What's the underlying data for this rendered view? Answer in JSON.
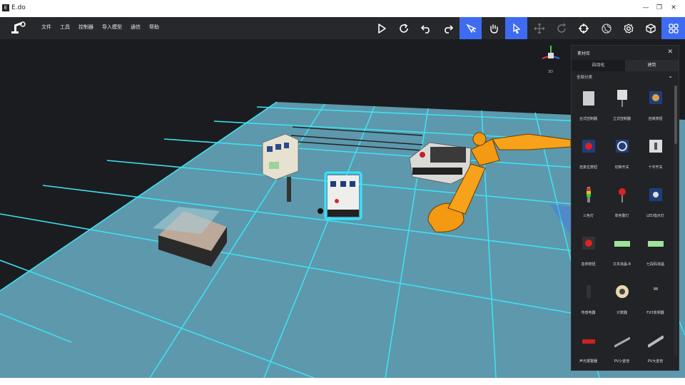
{
  "window": {
    "title": "E.do",
    "icon": "app-icon",
    "controls": [
      "—",
      "❐",
      "✕"
    ]
  },
  "menu": [
    "文件",
    "工具",
    "控制器",
    "导入模型",
    "通信",
    "帮助"
  ],
  "toolbar": {
    "buttons": [
      {
        "name": "play-icon",
        "active": false
      },
      {
        "name": "refresh-icon",
        "active": false
      },
      {
        "name": "undo-icon",
        "active": false
      },
      {
        "name": "redo-icon",
        "active": false
      },
      {
        "name": "pointer-pen-icon",
        "active": true
      },
      {
        "name": "hand-gesture-icon",
        "active": false
      },
      {
        "name": "cursor-icon",
        "active": true
      },
      {
        "name": "move-icon",
        "active": false
      },
      {
        "name": "rotate-icon",
        "active": false
      },
      {
        "name": "target-icon",
        "active": false
      },
      {
        "name": "globe-icon",
        "active": false
      },
      {
        "name": "settings-icon",
        "active": false
      },
      {
        "name": "cube-icon",
        "active": false
      },
      {
        "name": "apps-grid-icon",
        "active": true
      }
    ],
    "active_color": "#3d6cf2"
  },
  "viewport": {
    "view_label": "3D",
    "floor_color": "#5d98ad",
    "grid_line_color": "#3fe0f0"
  },
  "library_panel": {
    "title": "素材库",
    "close": "✕",
    "tabs": [
      "自动化",
      "建筑"
    ],
    "active_tab": 0,
    "category": "全部分类",
    "items": [
      {
        "label": "台式控制器",
        "icon": "desktop-controller-icon"
      },
      {
        "label": "立式控制器",
        "icon": "standing-controller-icon"
      },
      {
        "label": "自锁按钮",
        "icon": "self-lock-button-icon"
      },
      {
        "label": "自复位按钮",
        "icon": "reset-button-icon"
      },
      {
        "label": "切换开关",
        "icon": "toggle-switch-icon"
      },
      {
        "label": "十字开关",
        "icon": "cross-switch-icon"
      },
      {
        "label": "三色灯",
        "icon": "tri-color-light-icon"
      },
      {
        "label": "单色警灯",
        "icon": "warning-light-icon"
      },
      {
        "label": "LED指示灯",
        "icon": "led-indicator-icon"
      },
      {
        "label": "急停按钮",
        "icon": "emergency-stop-icon"
      },
      {
        "label": "文本液晶-8",
        "icon": "text-lcd-icon"
      },
      {
        "label": "七段码液晶",
        "icon": "seven-segment-lcd-icon"
      },
      {
        "label": "传感电器",
        "icon": "sensor-icon"
      },
      {
        "label": "计数器",
        "icon": "counter-icon"
      },
      {
        "label": "FX3变频器",
        "icon": "inverter-icon"
      },
      {
        "label": "声光报警器",
        "icon": "alarm-icon"
      },
      {
        "label": "PV小金管",
        "icon": "pv-small-tube-icon"
      },
      {
        "label": "PV大金管",
        "icon": "pv-large-tube-icon"
      }
    ]
  }
}
